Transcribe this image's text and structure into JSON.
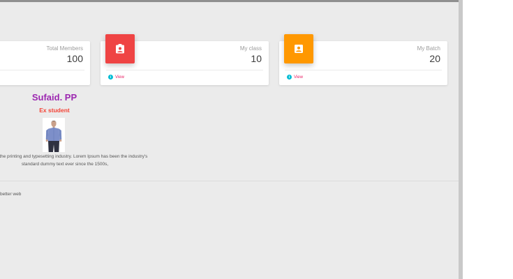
{
  "stats": [
    {
      "label": "Total Members",
      "value": "100",
      "link": "View",
      "icon": "none",
      "color": "#ffffff"
    },
    {
      "label": "My class",
      "value": "10",
      "link": "View",
      "icon": "contact-badge-icon",
      "color": "#ef4444"
    },
    {
      "label": "My Batch",
      "value": "20",
      "link": "View",
      "icon": "account-box-icon",
      "color": "#ff9800"
    }
  ],
  "profile": {
    "name": "Sufaid. PP",
    "role": "Ex student",
    "photo_icon": "person-photo",
    "description_line1": "y text of the printing and typesetting industry. Lorem Ipsum has been the industry's",
    "description_line2": "standard dummy text ever since the 1500s,"
  },
  "footer": {
    "text": "better web"
  },
  "colors": {
    "name": "#9c27b0",
    "role": "#f44336",
    "link": "#e91e63",
    "info": "#00bcd4",
    "background": "#ebebeb"
  }
}
